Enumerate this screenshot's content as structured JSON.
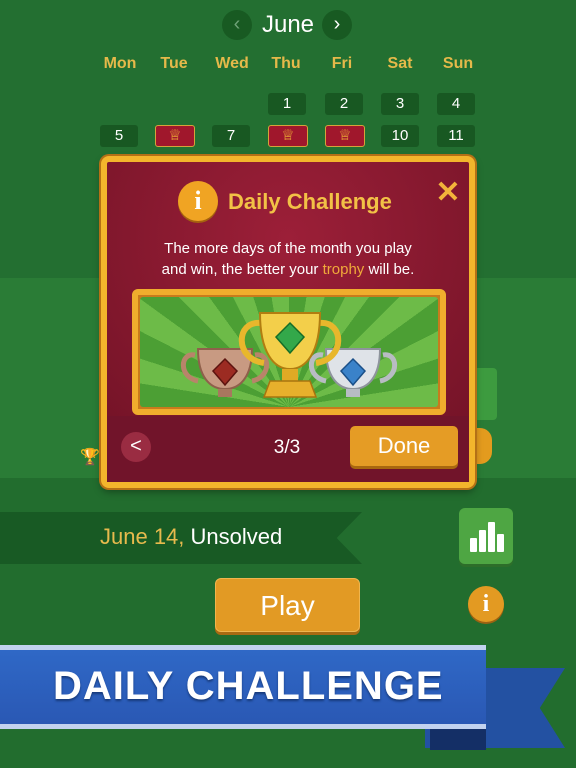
{
  "calendar": {
    "month": "June",
    "weekdays": [
      "Mon",
      "Tue",
      "Wed",
      "Thu",
      "Fri",
      "Sat",
      "Sun"
    ],
    "week1": [
      "1",
      "2",
      "3",
      "4"
    ],
    "week2": [
      "5",
      "",
      "7",
      "",
      "",
      "10",
      "11"
    ]
  },
  "status": {
    "date": "June 14,",
    "state": "Unsolved"
  },
  "actions": {
    "play_label": "Play",
    "info_label": "i"
  },
  "banner": {
    "text": "DAILY CHALLENGE"
  },
  "modal": {
    "icon_label": "i",
    "title": "Daily Challenge",
    "description_line1": "The more days of the month you play",
    "description_line2_prefix": "and win, the better your ",
    "description_highlight": "trophy",
    "description_line2_suffix": " will be.",
    "page": "3/3",
    "done_label": "Done",
    "close_label": "✕",
    "back_label": "<"
  },
  "icons": {
    "prev": "chevron-left-icon",
    "next": "chevron-right-icon",
    "crown": "crown-icon",
    "stats": "bar-chart-icon",
    "trophy": "trophy-icon"
  },
  "colors": {
    "felt": "#236f31",
    "gold": "#f3b52c",
    "modal_red": "#8a1830",
    "banner_blue": "#2a58b4",
    "accent_orange": "#e29a24"
  }
}
